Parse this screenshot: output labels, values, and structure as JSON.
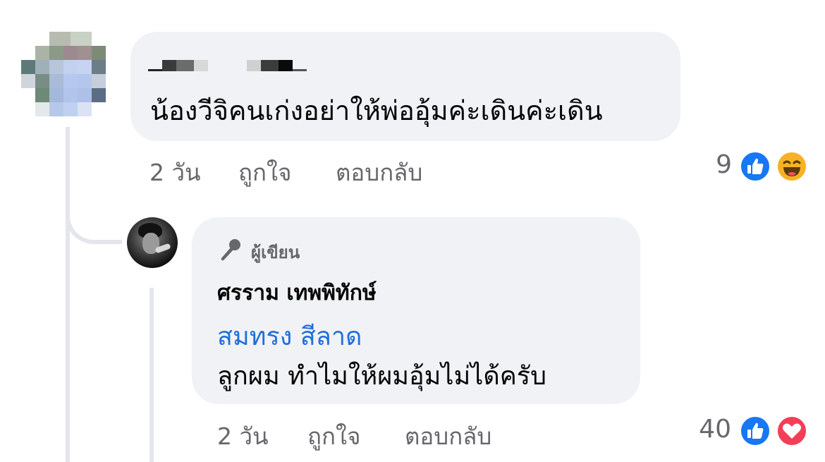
{
  "comment1": {
    "author_hidden": true,
    "text": "น้องวีจิคนเก่งอย่าให้พ่ออุ้มค่ะเดินค่ะเดิน",
    "time": "2 วัน",
    "like": "ถูกใจ",
    "reply": "ตอบกลับ",
    "reaction_count": "9",
    "reactions": [
      "like-icon",
      "haha-icon"
    ]
  },
  "comment2": {
    "badge": "ผู้เขียน",
    "author": "ศรราม เทพพิทักษ์",
    "mention": "สมทรง สีลาด",
    "text": "ลูกผม ทำไมให้ผมอุ้มไม่ได้ครับ",
    "time": "2 วัน",
    "like": "ถูกใจ",
    "reply": "ตอบกลับ",
    "reaction_count": "40",
    "reactions": [
      "like-icon",
      "love-icon"
    ]
  },
  "colors": {
    "bubble": "#f0f2f5",
    "secondary_text": "#65676b",
    "mention": "#216fdb",
    "like_blue": "#1877f2",
    "love_red": "#f33e58",
    "haha_yellow": "#f7b125"
  }
}
